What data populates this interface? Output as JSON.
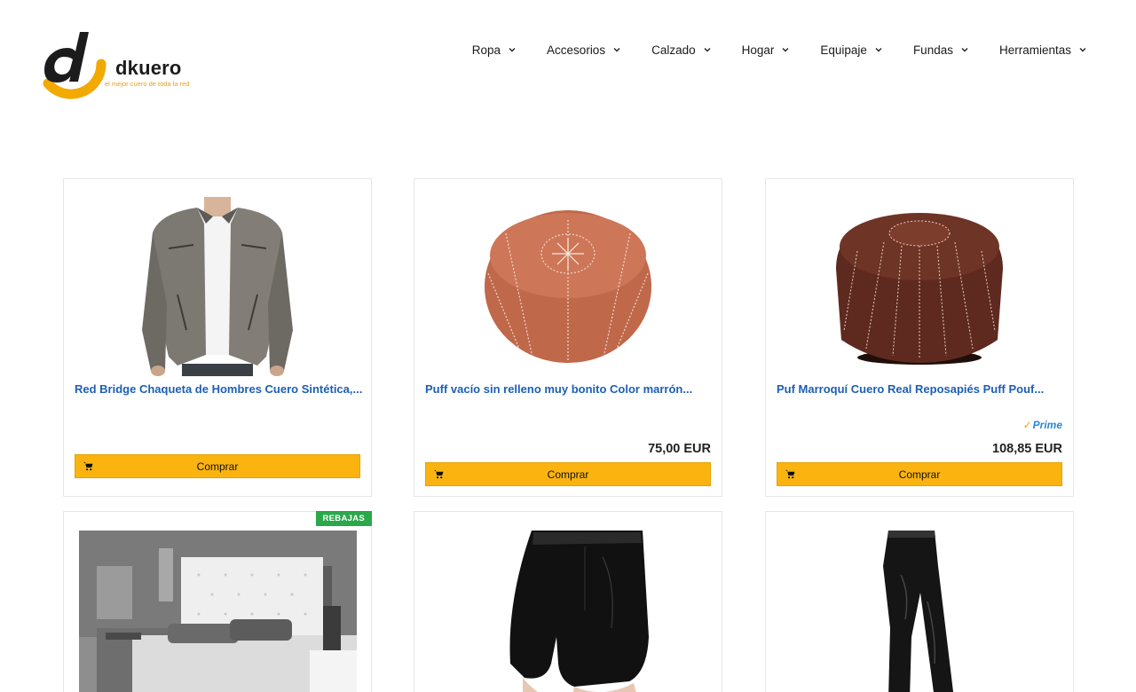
{
  "brand": {
    "name": "dkuero",
    "tagline": "el mejor cuero de toda la red",
    "primary_color": "#f2a900",
    "dark_color": "#1c1c1c"
  },
  "nav": {
    "items": [
      {
        "label": "Ropa",
        "icon": "chevron-down-icon"
      },
      {
        "label": "Accesorios",
        "icon": "chevron-down-icon"
      },
      {
        "label": "Calzado",
        "icon": "chevron-down-icon"
      },
      {
        "label": "Hogar",
        "icon": "chevron-down-icon"
      },
      {
        "label": "Equipaje",
        "icon": "chevron-down-icon"
      },
      {
        "label": "Fundas",
        "icon": "chevron-down-icon"
      },
      {
        "label": "Herramientas",
        "icon": "chevron-down-icon"
      }
    ]
  },
  "products": [
    {
      "title": "Red Bridge Chaqueta de Hombres Cuero Sintética,...",
      "price": "",
      "prime": false,
      "button": "Comprar",
      "badge": "",
      "image": "leather-jacket-image"
    },
    {
      "title": "Puff vacío sin relleno muy bonito Color marrón...",
      "price": "75,00 EUR",
      "prime": false,
      "button": "Comprar",
      "badge": "",
      "image": "leather-pouf-tan-image"
    },
    {
      "title": "Puf Marroquí Cuero Real Reposapiés Puff Pouf...",
      "price": "108,85 EUR",
      "prime": true,
      "prime_label": "Prime",
      "button": "Comprar",
      "badge": "",
      "image": "leather-pouf-brown-image"
    },
    {
      "title": "",
      "price": "",
      "prime": false,
      "button": "",
      "badge": "REBAJAS",
      "image": "leather-headboard-bedroom-image"
    },
    {
      "title": "",
      "price": "",
      "prime": false,
      "button": "",
      "badge": "",
      "image": "leather-shorts-image"
    },
    {
      "title": "",
      "price": "",
      "prime": false,
      "button": "",
      "badge": "",
      "image": "leather-pants-image"
    }
  ],
  "colors": {
    "title_link": "#1d5fb5",
    "button_bg": "#fbb40f",
    "sale_badge": "#2aa84a",
    "prime_blue": "#2a8ad0"
  }
}
